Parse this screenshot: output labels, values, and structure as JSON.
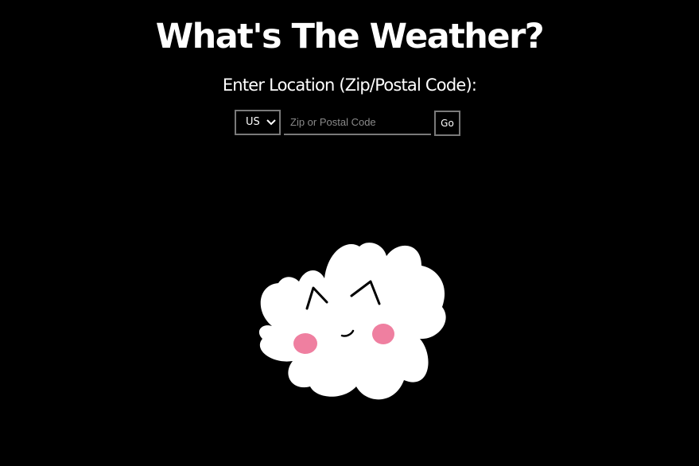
{
  "header": {
    "title": "What's The Weather?",
    "prompt": "Enter Location (Zip/Postal Code):"
  },
  "form": {
    "country_selected": "US",
    "zip_placeholder": "Zip or Postal Code",
    "zip_value": "",
    "go_label": "Go"
  },
  "colors": {
    "background": "#000000",
    "text": "#ffffff",
    "border": "#7a7a7a",
    "placeholder": "#8a8a8a",
    "cloud": "#ffffff",
    "blush": "#ef7fa0"
  },
  "icons": {
    "mascot": "cloud-cat-mascot-icon",
    "select_arrow": "chevron-down-icon"
  }
}
